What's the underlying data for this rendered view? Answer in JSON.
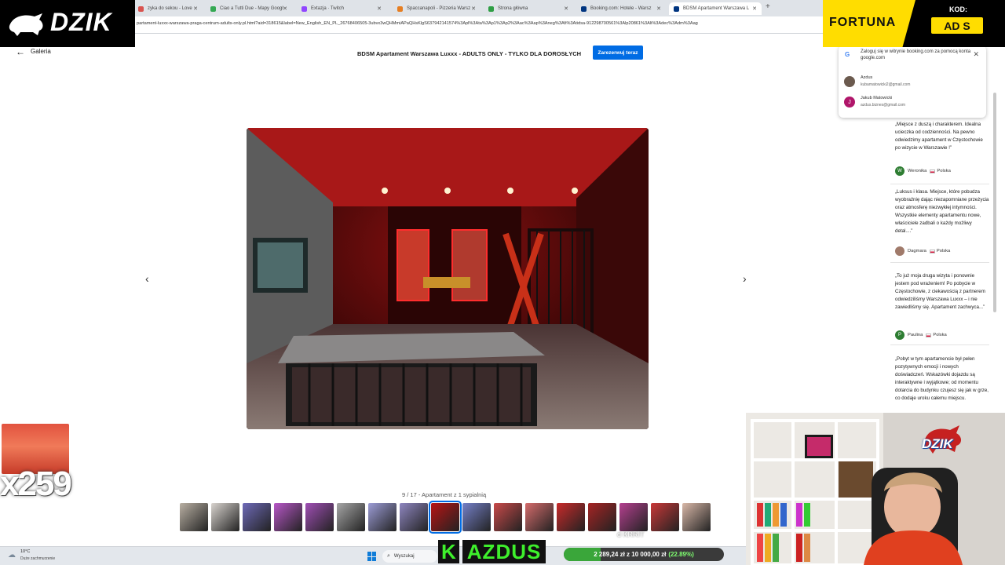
{
  "browser": {
    "tabs": [
      {
        "label": "zyka do sekou - Love",
        "favicon_color": "#d9534f"
      },
      {
        "label": "Ciao a Tutti Due - Mapy Googl",
        "favicon_color": "#34a853"
      },
      {
        "label": "Extazja · Twitch",
        "favicon_color": "#9146ff"
      },
      {
        "label": "Spaccanapoli - Pizzeria Warsz",
        "favicon_color": "#e67e22"
      },
      {
        "label": "Strona główna",
        "favicon_color": "#2e9e44"
      },
      {
        "label": "Booking.com: Hotele - Warsz",
        "favicon_color": "#003580"
      },
      {
        "label": "BDSM Apartament Warszawa L",
        "favicon_color": "#003580"
      }
    ],
    "url": "partament-luxxx-warszawa-praga-centrum-adults-only.pl.html?aid=318615&label=New_English_EN_PL_26768406505-3ubvx3wQHMmiAPaQHsKlgS637942141574%3Apl%3Ata%3Ap1%3Ap2%3Aac%3Aap%3Aneg%3Afi%3Atidsa-912298700561%3Alp20861%3Ali%3Adec%3Adm%3Aag"
  },
  "gallery": {
    "back_label": "Galeria",
    "title": "BDSM Apartament Warszawa Luxxx - ADULTS ONLY - TYLKO DLA DOROSŁYCH",
    "reserve_label": "Zarezerwuj teraz",
    "counter": "9 / 17 - Apartament z 1 sypialnią",
    "selected_index": 8,
    "thumb_colors": [
      "#b9b0a3",
      "#d9d4cf",
      "#6e6ab8",
      "#b857c8",
      "#a04fb5",
      "#a6a6a6",
      "#9c9cd6",
      "#8e86c0",
      "#b81414",
      "#7580c9",
      "#c94a4a",
      "#d56b6b",
      "#c92a2a",
      "#a62424",
      "#b4408f",
      "#c93838",
      "#d9b8a8"
    ]
  },
  "google_popup": {
    "title": "Zaloguj się w witrynie booking.com za pomocą konta google.com",
    "accounts": [
      {
        "name": "Azdus",
        "email": "kubamatowicki2@gmail.com",
        "avatar_color": "#6b5a4e"
      },
      {
        "name": "Jakub Matowicki",
        "email": "azdus.biznes@gmail.com",
        "avatar_letter": "J",
        "avatar_color": "#b0166a"
      }
    ]
  },
  "reviews": [
    {
      "text": "„Miejsce z duszą i charakterem. Idealna ucieczka od codzienności. Na pewno odwiedzimy apartament w Częstochowie po wizycie w Warszawie !”",
      "author": "Weronika",
      "country": "Polska",
      "avatar_letter": "W",
      "avatar_color": "#2e7d32"
    },
    {
      "text": "„Luksus i klasa. Miejsce, które pobudza wyobraźnię dając niezapomniane przeżycia oraz atmosferę niezwykłej intymności. Wszystkie elementy apartamentu nowe, właściciele zadbali o każdy możliwy detal....”",
      "author": "Dagmara",
      "country": "Polska",
      "avatar_letter": "",
      "avatar_color": "#a07a6a"
    },
    {
      "text": "„To już moja druga wizyta i ponownie jestem pod wrażeniem! Po pobycie w Częstochowie, z ciekawością z partnerem odwiedziliśmy Warszawa Luxxx – i nie zawiedliśmy się. Apartament zachwyca...”",
      "author": "Paulina",
      "country": "Polska",
      "avatar_letter": "P",
      "avatar_color": "#2e7d32"
    },
    {
      "text": "„Pobyt w tym apartamencie był pełen pozytywnych emocji i nowych doświadczeń. Wskazówki dojazdu są interaktywne i wyjątkowe; od momentu dotarcia do budynku czujesz się jak w grze, co dodaje uroku całemu miejscu.",
      "author": "",
      "country": "",
      "avatar_letter": "",
      "avatar_color": ""
    }
  ],
  "overlays": {
    "dzik_logo": "DZIK",
    "fortuna": "FORTUNA",
    "kod_label": "KOD:",
    "kod_code": "AD S",
    "sub_count": "x259",
    "webcam_logo": "DZIK",
    "streamer_k": "K",
    "streamer_name": "AZDUS",
    "donation_amount": "2 289,24 zł",
    "donation_separator": "z",
    "donation_goal": "10 000,00 zł",
    "donation_percent": "(22.89%)",
    "donation_fraction": 0.2289,
    "small_text": "d KRRIT"
  },
  "taskbar": {
    "weather_temp": "10°C",
    "weather_desc": "Duże zachmurzenie",
    "search_label": "Wyszukaj"
  }
}
